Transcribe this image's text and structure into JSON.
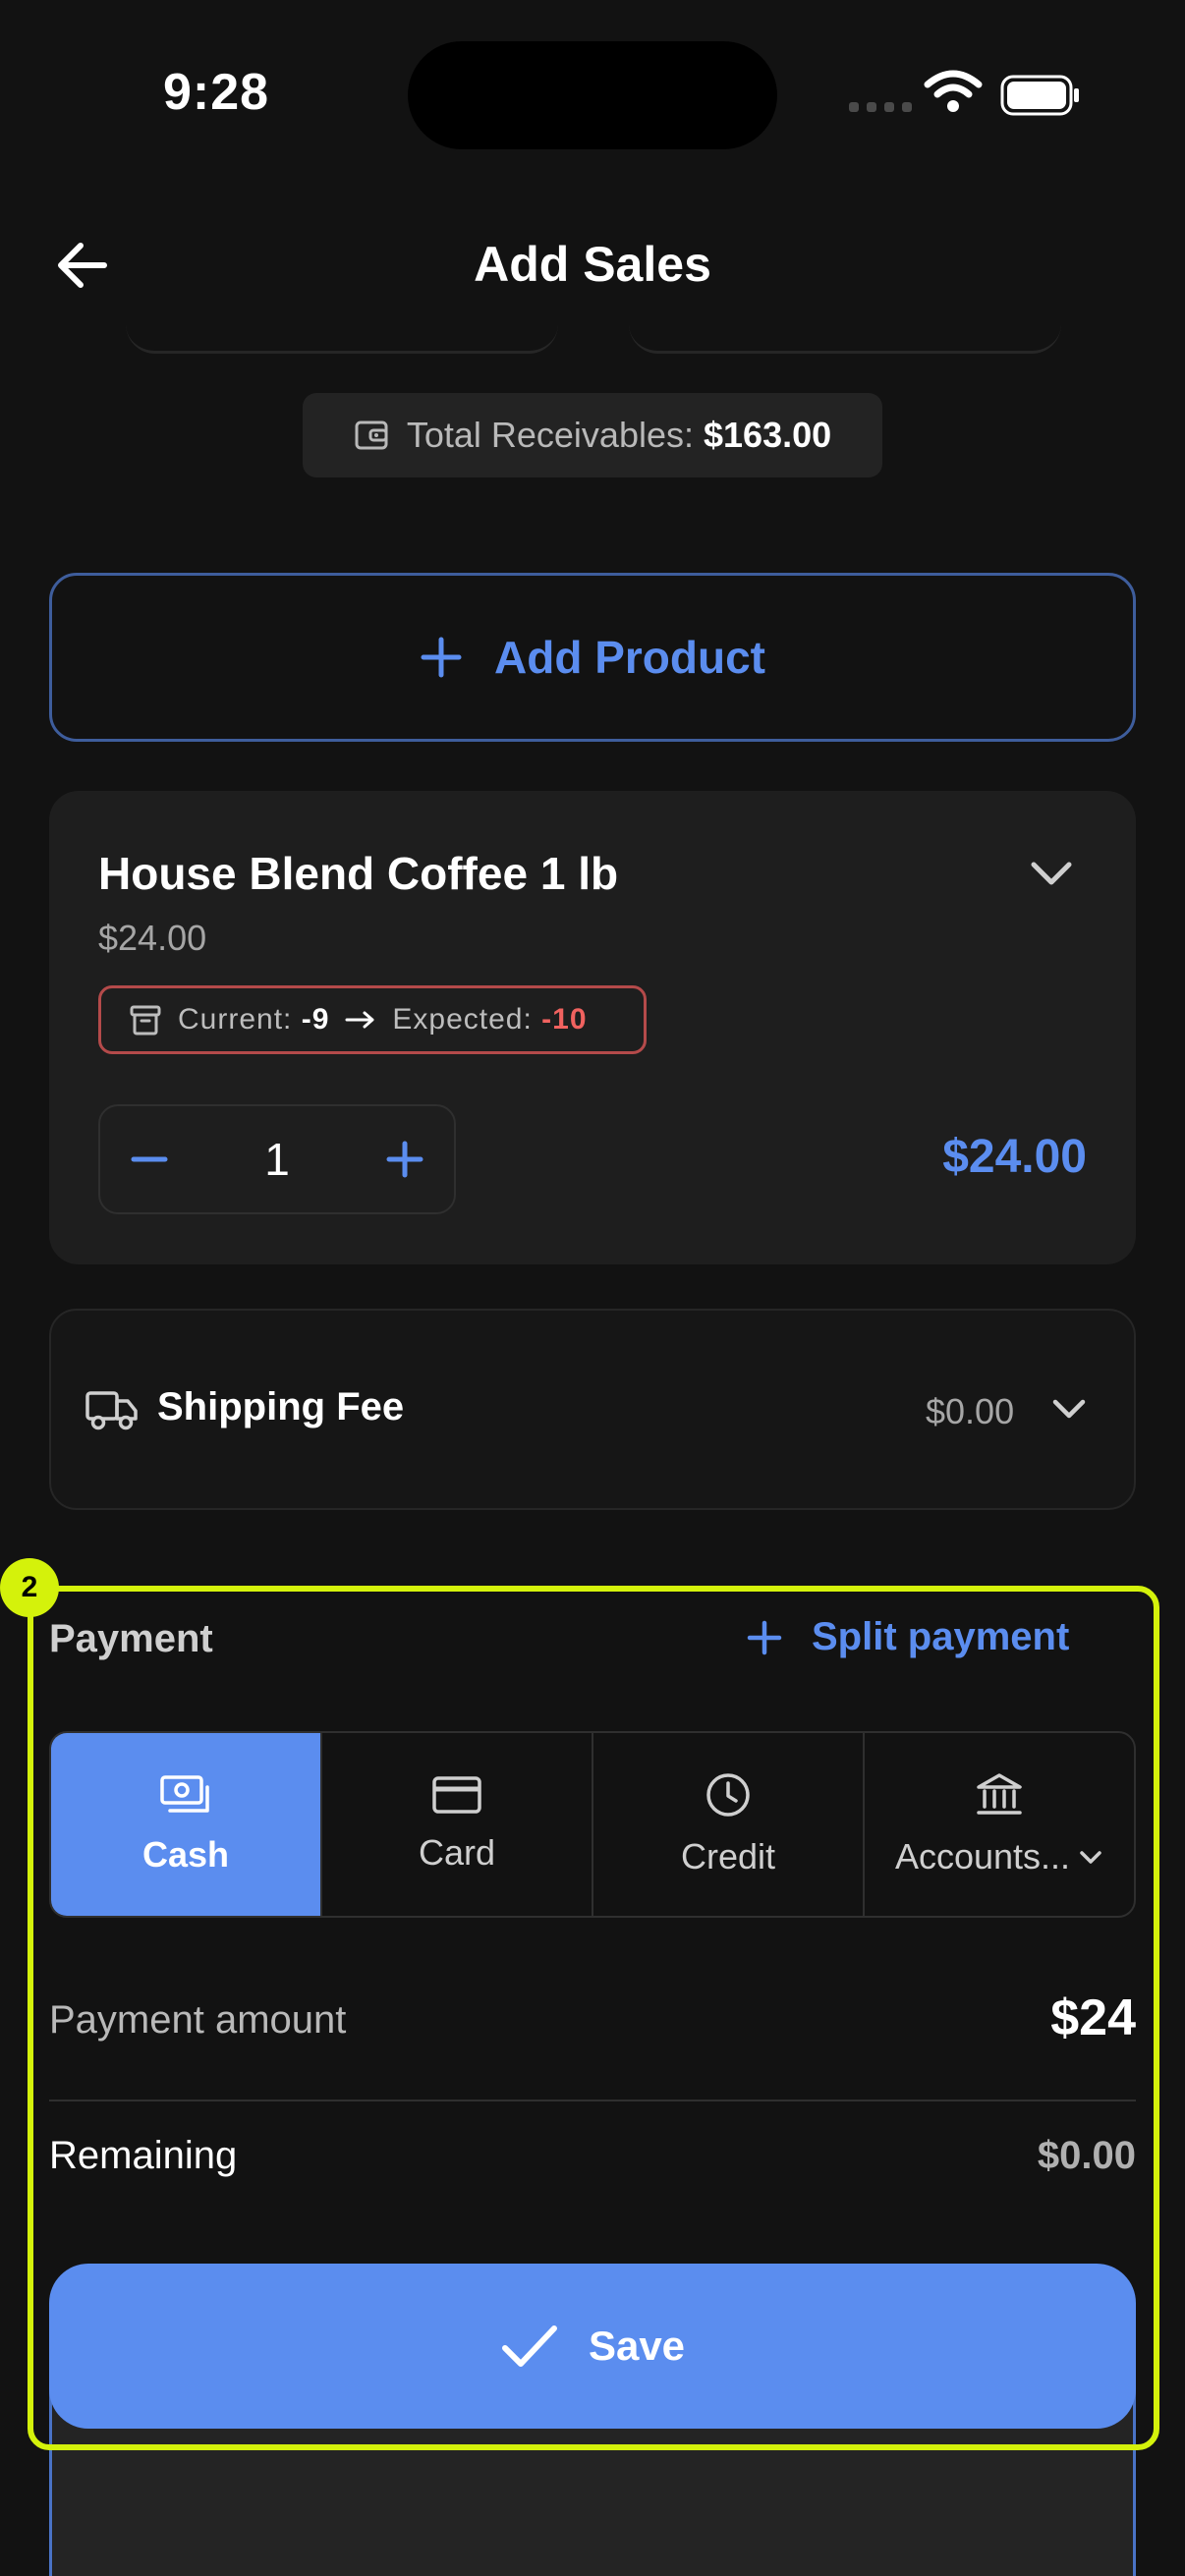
{
  "status_bar": {
    "time": "9:28"
  },
  "header": {
    "title": "Add Sales"
  },
  "receivables": {
    "label": "Total Receivables:",
    "amount": "$163.00"
  },
  "add_product": {
    "label": "Add Product"
  },
  "product": {
    "name": "House Blend Coffee 1 lb",
    "price": "$24.00",
    "stock": {
      "current_label": "Current:",
      "current": "-9",
      "expected_label": "Expected:",
      "expected": "-10"
    },
    "quantity": "1",
    "line_total": "$24.00"
  },
  "shipping": {
    "label": "Shipping Fee",
    "value": "$0.00"
  },
  "annotation": {
    "badge": "2"
  },
  "payment": {
    "title": "Payment",
    "split_label": "Split payment",
    "methods": [
      {
        "label": "Cash",
        "icon": "cash-icon",
        "active": true
      },
      {
        "label": "Card",
        "icon": "card-icon",
        "active": false
      },
      {
        "label": "Credit",
        "icon": "clock-icon",
        "active": false
      },
      {
        "label": "Accounts...",
        "icon": "bank-icon",
        "active": false
      }
    ],
    "amount_label": "Payment amount",
    "amount_value": "$24",
    "remaining_label": "Remaining",
    "remaining_value": "$0.00"
  },
  "save": {
    "label": "Save"
  },
  "colors": {
    "accent": "#5b8def",
    "highlight": "#d4f20b",
    "negative": "#f0625f",
    "background": "#121212"
  }
}
